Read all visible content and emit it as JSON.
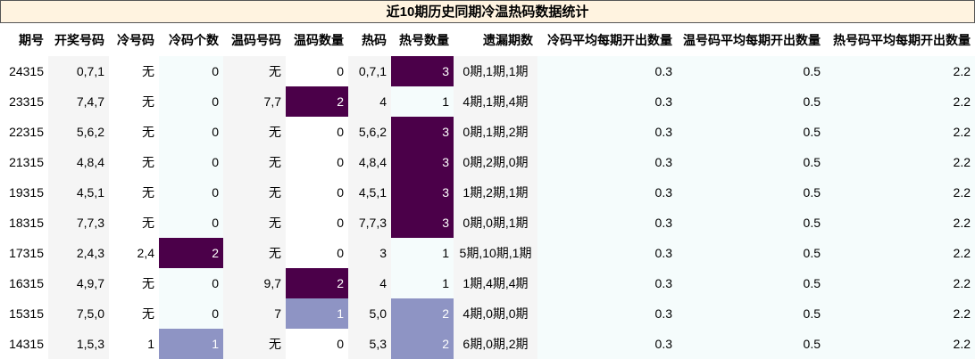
{
  "title": "近10期历史同期冷温热码数据统计",
  "columns": [
    "期号",
    "开奖号码",
    "冷号码",
    "冷码个数",
    "温码号码",
    "温码数量",
    "热码",
    "热号数量",
    "遗漏期数",
    "冷码平均每期开出数量",
    "温号码平均每期开出数量",
    "热号码平均每期开出数量"
  ],
  "rows": [
    {
      "issue": "24315",
      "draw": "0,7,1",
      "cold": "无",
      "cold_count": "0",
      "warm": "无",
      "warm_count": "0",
      "hot": "0,7,1",
      "hot_count": "3",
      "miss": "0期,1期,1期",
      "cold_avg": "0.3",
      "warm_avg": "0.5",
      "hot_avg": "2.2"
    },
    {
      "issue": "23315",
      "draw": "7,4,7",
      "cold": "无",
      "cold_count": "0",
      "warm": "7,7",
      "warm_count": "2",
      "hot": "4",
      "hot_count": "1",
      "miss": "4期,1期,4期",
      "cold_avg": "0.3",
      "warm_avg": "0.5",
      "hot_avg": "2.2"
    },
    {
      "issue": "22315",
      "draw": "5,6,2",
      "cold": "无",
      "cold_count": "0",
      "warm": "无",
      "warm_count": "0",
      "hot": "5,6,2",
      "hot_count": "3",
      "miss": "0期,1期,2期",
      "cold_avg": "0.3",
      "warm_avg": "0.5",
      "hot_avg": "2.2"
    },
    {
      "issue": "21315",
      "draw": "4,8,4",
      "cold": "无",
      "cold_count": "0",
      "warm": "无",
      "warm_count": "0",
      "hot": "4,8,4",
      "hot_count": "3",
      "miss": "0期,2期,0期",
      "cold_avg": "0.3",
      "warm_avg": "0.5",
      "hot_avg": "2.2"
    },
    {
      "issue": "19315",
      "draw": "4,5,1",
      "cold": "无",
      "cold_count": "0",
      "warm": "无",
      "warm_count": "0",
      "hot": "4,5,1",
      "hot_count": "3",
      "miss": "1期,2期,1期",
      "cold_avg": "0.3",
      "warm_avg": "0.5",
      "hot_avg": "2.2"
    },
    {
      "issue": "18315",
      "draw": "7,7,3",
      "cold": "无",
      "cold_count": "0",
      "warm": "无",
      "warm_count": "0",
      "hot": "7,7,3",
      "hot_count": "3",
      "miss": "0期,0期,1期",
      "cold_avg": "0.3",
      "warm_avg": "0.5",
      "hot_avg": "2.2"
    },
    {
      "issue": "17315",
      "draw": "2,4,3",
      "cold": "2,4",
      "cold_count": "2",
      "warm": "无",
      "warm_count": "0",
      "hot": "3",
      "hot_count": "1",
      "miss": "5期,10期,1期",
      "cold_avg": "0.3",
      "warm_avg": "0.5",
      "hot_avg": "2.2"
    },
    {
      "issue": "16315",
      "draw": "4,9,7",
      "cold": "无",
      "cold_count": "0",
      "warm": "9,7",
      "warm_count": "2",
      "hot": "4",
      "hot_count": "1",
      "miss": "1期,4期,4期",
      "cold_avg": "0.3",
      "warm_avg": "0.5",
      "hot_avg": "2.2"
    },
    {
      "issue": "15315",
      "draw": "7,5,0",
      "cold": "无",
      "cold_count": "0",
      "warm": "7",
      "warm_count": "1",
      "hot": "5,0",
      "hot_count": "2",
      "miss": "4期,0期,0期",
      "cold_avg": "0.3",
      "warm_avg": "0.5",
      "hot_avg": "2.2"
    },
    {
      "issue": "14315",
      "draw": "1,5,3",
      "cold": "1",
      "cold_count": "1",
      "warm": "无",
      "warm_count": "0",
      "hot": "5,3",
      "hot_count": "2",
      "miss": "6期,0期,2期",
      "cold_avg": "0.3",
      "warm_avg": "0.5",
      "hot_avg": "2.2"
    }
  ],
  "colors": {
    "title_bg": "#fff3e0",
    "shade_light": "#f5f5f5",
    "shade_mint": "#f5fcfc",
    "heat_dark": "#4b0049",
    "heat_mid": "#8e94c4"
  }
}
